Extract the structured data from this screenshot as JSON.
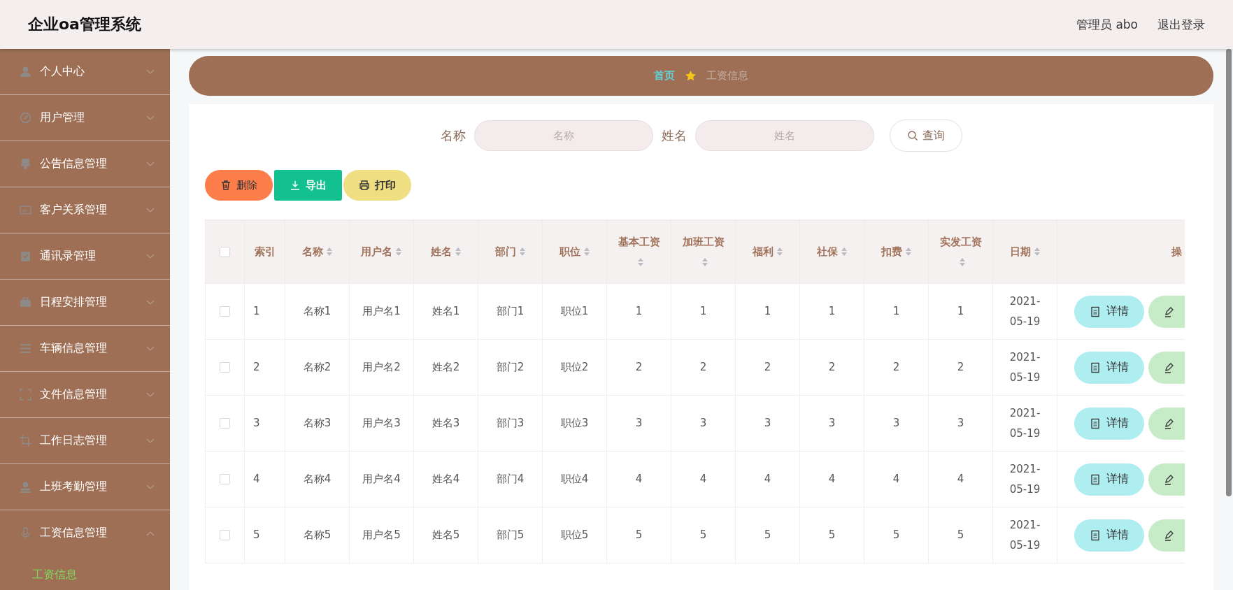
{
  "header": {
    "title": "企业oa管理系统",
    "user_label": "管理员 abo",
    "logout": "退出登录"
  },
  "sidebar": {
    "items": [
      {
        "label": "个人中心",
        "expanded": false
      },
      {
        "label": "用户管理",
        "expanded": false
      },
      {
        "label": "公告信息管理",
        "expanded": false
      },
      {
        "label": "客户关系管理",
        "expanded": false
      },
      {
        "label": "通讯录管理",
        "expanded": false
      },
      {
        "label": "日程安排管理",
        "expanded": false
      },
      {
        "label": "车辆信息管理",
        "expanded": false
      },
      {
        "label": "文件信息管理",
        "expanded": false
      },
      {
        "label": "工作日志管理",
        "expanded": false
      },
      {
        "label": "上班考勤管理",
        "expanded": false
      },
      {
        "label": "工资信息管理",
        "expanded": true,
        "children": [
          {
            "label": "工资信息",
            "selected": true
          }
        ]
      }
    ]
  },
  "breadcrumb": {
    "home": "首页",
    "current": "工资信息"
  },
  "search": {
    "fields": [
      {
        "label": "名称",
        "placeholder": "名称"
      },
      {
        "label": "姓名",
        "placeholder": "姓名"
      }
    ],
    "button": "查询"
  },
  "actions": [
    {
      "kind": "delete",
      "label": "删除"
    },
    {
      "kind": "export",
      "label": "导出"
    },
    {
      "kind": "print",
      "label": "打印"
    }
  ],
  "table": {
    "select_all_checked": false,
    "columns": [
      {
        "label": "索引",
        "sortable": false
      },
      {
        "label": "名称",
        "sortable": true
      },
      {
        "label": "用户名",
        "sortable": true
      },
      {
        "label": "姓名",
        "sortable": true
      },
      {
        "label": "部门",
        "sortable": true
      },
      {
        "label": "职位",
        "sortable": true
      },
      {
        "label": "基本工资",
        "sortable": true
      },
      {
        "label": "加班工资",
        "sortable": true
      },
      {
        "label": "福利",
        "sortable": true
      },
      {
        "label": "社保",
        "sortable": true
      },
      {
        "label": "扣费",
        "sortable": true
      },
      {
        "label": "实发工资",
        "sortable": true
      },
      {
        "label": "日期",
        "sortable": true
      },
      {
        "label": "操",
        "sortable": false
      }
    ],
    "rows": [
      {
        "checked": false,
        "cells": [
          "1",
          "名称1",
          "用户名1",
          "姓名1",
          "部门1",
          "职位1",
          "1",
          "1",
          "1",
          "1",
          "1",
          "1",
          "2021-05-19"
        ],
        "actions": [
          {
            "kind": "detail",
            "label": "详情"
          },
          {
            "kind": "edit"
          }
        ]
      },
      {
        "checked": false,
        "cells": [
          "2",
          "名称2",
          "用户名2",
          "姓名2",
          "部门2",
          "职位2",
          "2",
          "2",
          "2",
          "2",
          "2",
          "2",
          "2021-05-19"
        ],
        "actions": [
          {
            "kind": "detail",
            "label": "详情"
          },
          {
            "kind": "edit"
          }
        ]
      },
      {
        "checked": false,
        "cells": [
          "3",
          "名称3",
          "用户名3",
          "姓名3",
          "部门3",
          "职位3",
          "3",
          "3",
          "3",
          "3",
          "3",
          "3",
          "2021-05-19"
        ],
        "actions": [
          {
            "kind": "detail",
            "label": "详情"
          },
          {
            "kind": "edit"
          }
        ]
      },
      {
        "checked": false,
        "cells": [
          "4",
          "名称4",
          "用户名4",
          "姓名4",
          "部门4",
          "职位4",
          "4",
          "4",
          "4",
          "4",
          "4",
          "4",
          "2021-05-19"
        ],
        "actions": [
          {
            "kind": "detail",
            "label": "详情"
          },
          {
            "kind": "edit"
          }
        ]
      },
      {
        "checked": false,
        "cells": [
          "5",
          "名称5",
          "用户名5",
          "姓名5",
          "部门5",
          "职位5",
          "5",
          "5",
          "5",
          "5",
          "5",
          "5",
          "2021-05-19"
        ],
        "actions": [
          {
            "kind": "detail",
            "label": "详情"
          },
          {
            "kind": "edit"
          }
        ]
      }
    ]
  }
}
